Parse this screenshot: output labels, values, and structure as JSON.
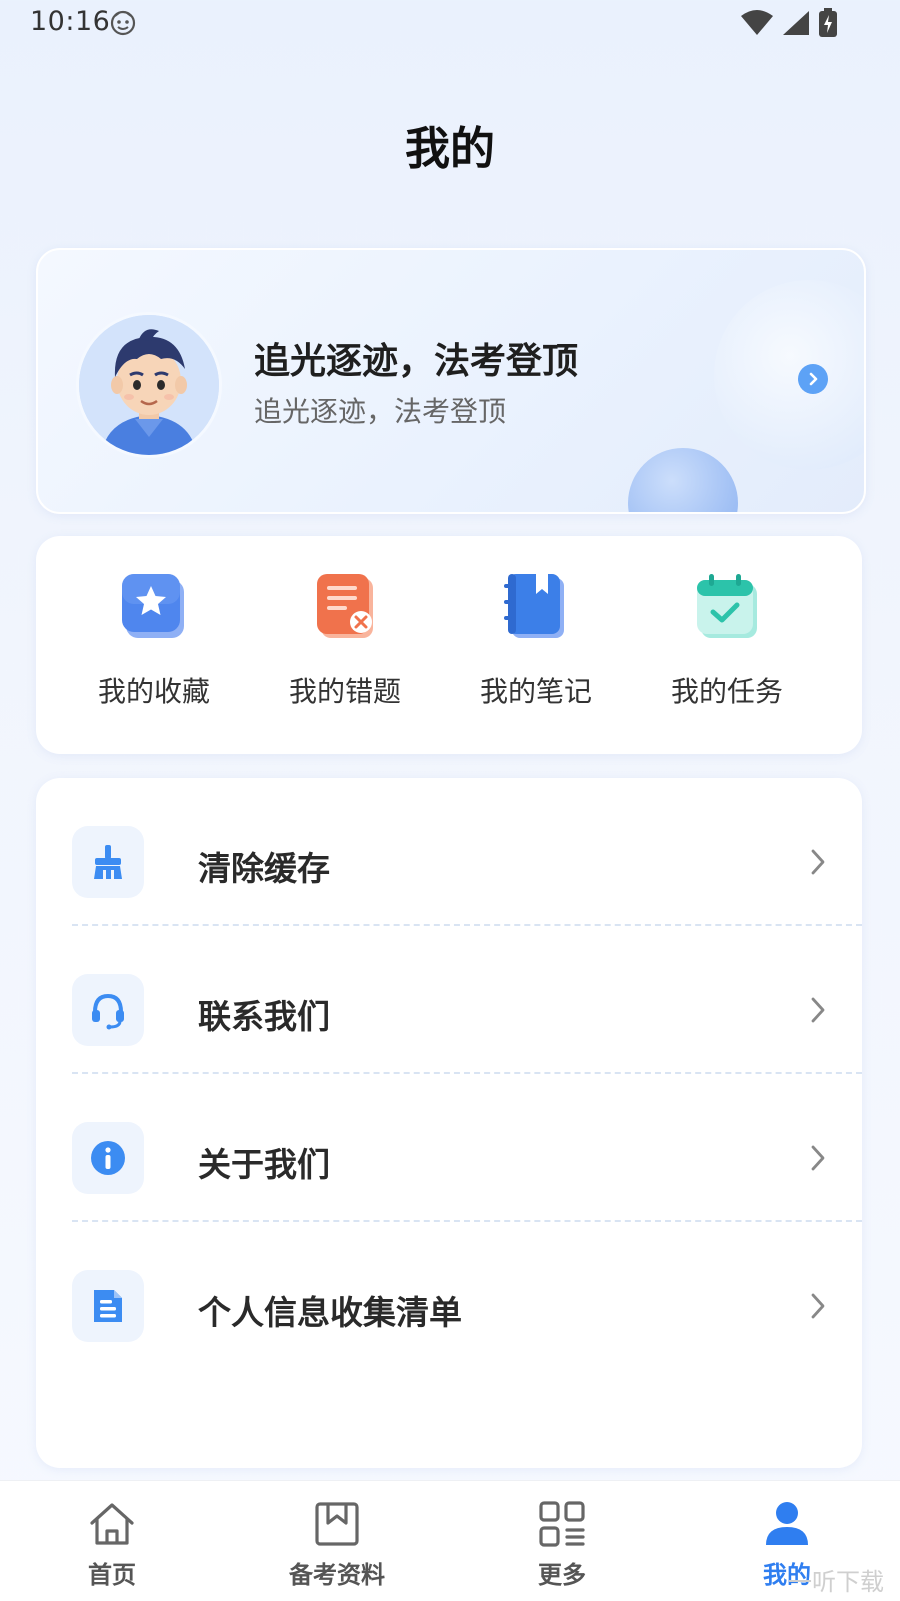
{
  "status": {
    "time": "10:16"
  },
  "page": {
    "title": "我的"
  },
  "profile": {
    "name": "追光逐迹，法考登顶",
    "subtitle": "追光逐迹，法考登顶"
  },
  "quick_actions": [
    {
      "label": "我的收藏",
      "icon": "star-icon"
    },
    {
      "label": "我的错题",
      "icon": "wrong-questions-icon"
    },
    {
      "label": "我的笔记",
      "icon": "notebook-icon"
    },
    {
      "label": "我的任务",
      "icon": "calendar-check-icon"
    }
  ],
  "settings": [
    {
      "label": "清除缓存",
      "icon": "broom-icon"
    },
    {
      "label": "联系我们",
      "icon": "headset-icon"
    },
    {
      "label": "关于我们",
      "icon": "info-icon"
    },
    {
      "label": "个人信息收集清单",
      "icon": "document-icon"
    }
  ],
  "bottom_nav": [
    {
      "label": "首页",
      "icon": "home-icon",
      "active": false
    },
    {
      "label": "备考资料",
      "icon": "bookmark-icon",
      "active": false
    },
    {
      "label": "更多",
      "icon": "grid-icon",
      "active": false
    },
    {
      "label": "我的",
      "icon": "user-icon",
      "active": true
    }
  ],
  "watermark": "一听下载",
  "colors": {
    "accent": "#2f7ef0",
    "icon_blue": "#3c8cf2",
    "background": "#eaf1fd"
  }
}
